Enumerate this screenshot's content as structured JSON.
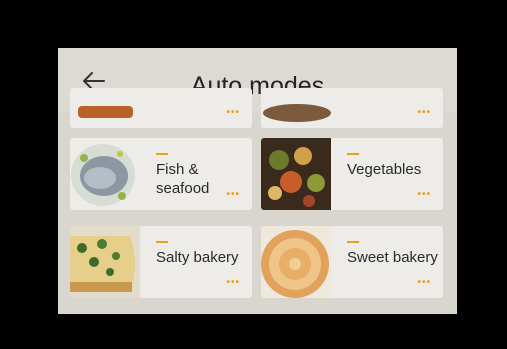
{
  "screen": {
    "title": "Auto modes",
    "back_icon": "arrow-left-icon"
  },
  "cards": [
    {
      "label": "Fish &\nseafood",
      "image": "fish-dish-image"
    },
    {
      "label": "Vegetables",
      "image": "vegetables-dish-image"
    },
    {
      "label": "Salty bakery",
      "image": "quiche-image"
    },
    {
      "label": "Sweet bakery",
      "image": "apple-tart-image"
    }
  ],
  "more_icon": "more-dots-icon",
  "accent_color": "#e8a01f"
}
